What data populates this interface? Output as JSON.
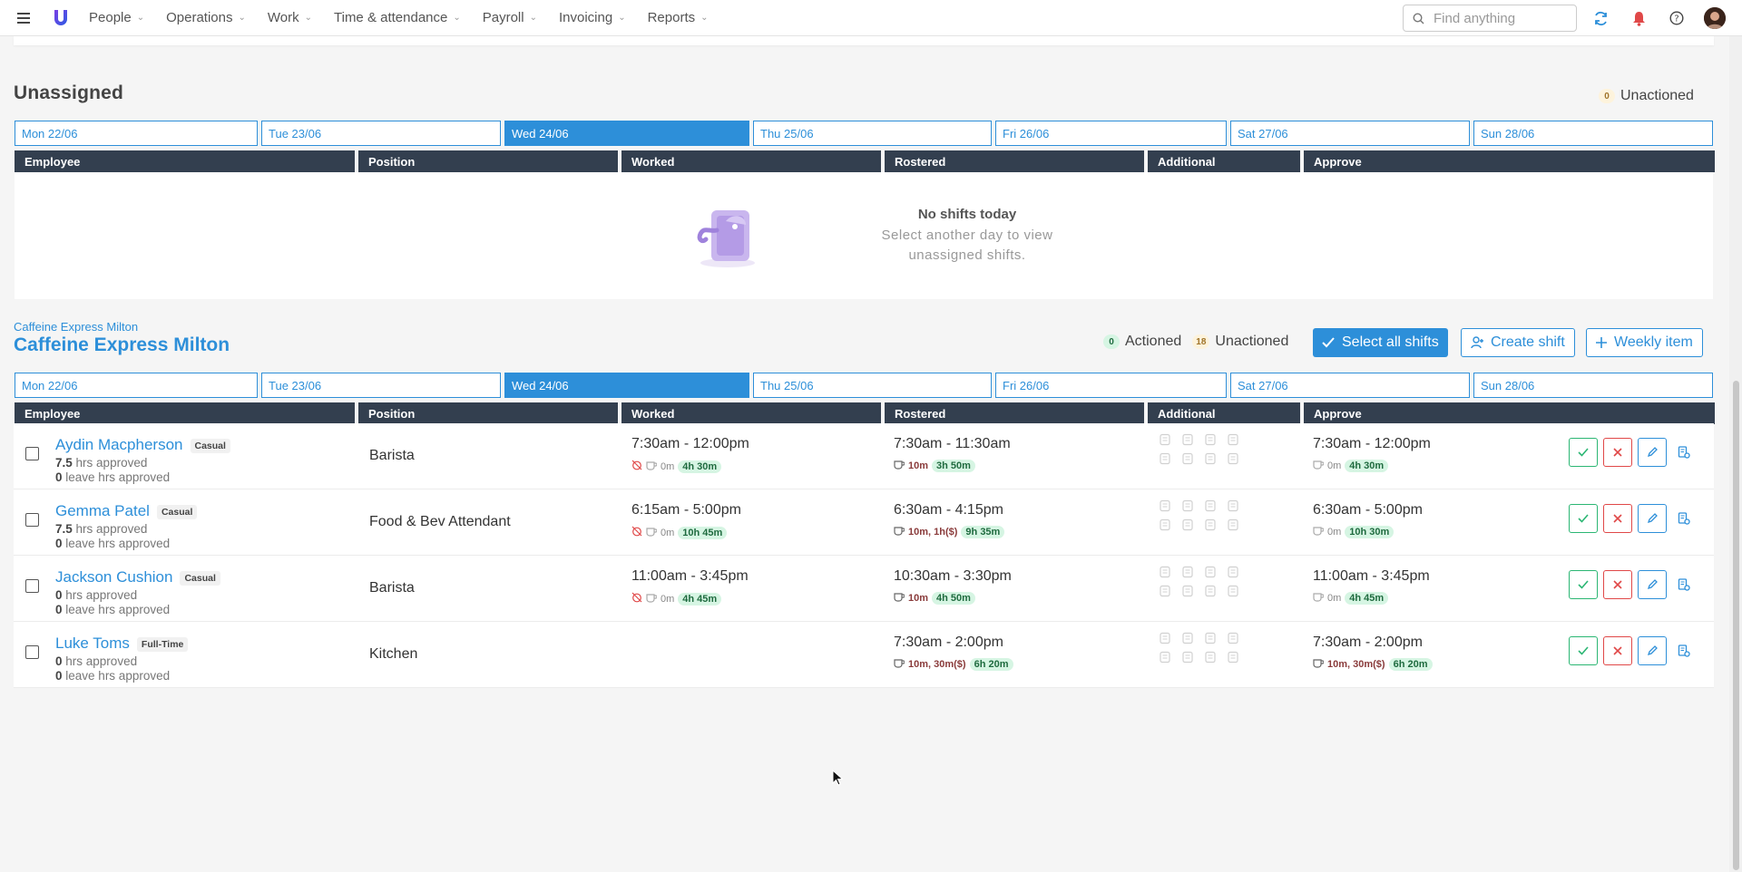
{
  "nav": {
    "items": [
      "People",
      "Operations",
      "Work",
      "Time & attendance",
      "Payroll",
      "Invoicing",
      "Reports"
    ],
    "search_placeholder": "Find anything"
  },
  "unassigned": {
    "title": "Unassigned",
    "unactioned_count": "0",
    "unactioned_label": "Unactioned",
    "empty_title": "No shifts today",
    "empty_line1": "Select another day to view",
    "empty_line2": "unassigned shifts."
  },
  "days": [
    "Mon 22/06",
    "Tue 23/06",
    "Wed 24/06",
    "Thu 25/06",
    "Fri 26/06",
    "Sat 27/06",
    "Sun 28/06"
  ],
  "active_day": "Wed 24/06",
  "columns": [
    "Employee",
    "Position",
    "Worked",
    "Rostered",
    "Additional",
    "Approve"
  ],
  "site": {
    "small_name": "Caffeine Express Milton",
    "name": "Caffeine Express Milton",
    "actioned_count": "0",
    "actioned_label": "Actioned",
    "unactioned_count": "18",
    "unactioned_label": "Unactioned",
    "select_all_label": "Select all shifts",
    "create_shift_label": "Create shift",
    "weekly_item_label": "Weekly item"
  },
  "rows": [
    {
      "name": "Aydin Macpherson",
      "type": "Casual",
      "hrs": "7.5",
      "hrs_label": "hrs approved",
      "leave": "0",
      "leave_label": "leave hrs approved",
      "position": "Barista",
      "worked": "7:30am - 12:00pm",
      "worked_break": "0m",
      "worked_total": "4h 30m",
      "rostered": "7:30am - 11:30am",
      "rostered_break": "10m",
      "rostered_total": "3h 50m",
      "approve": "7:30am - 12:00pm",
      "approve_break": "0m",
      "approve_total": "4h 30m"
    },
    {
      "name": "Gemma Patel",
      "type": "Casual",
      "hrs": "7.5",
      "hrs_label": "hrs approved",
      "leave": "0",
      "leave_label": "leave hrs approved",
      "position": "Food & Bev Attendant",
      "worked": "6:15am - 5:00pm",
      "worked_break": "0m",
      "worked_total": "10h 45m",
      "rostered": "6:30am - 4:15pm",
      "rostered_break": "10m, 1h($)",
      "rostered_total": "9h 35m",
      "approve": "6:30am - 5:00pm",
      "approve_break": "0m",
      "approve_total": "10h 30m"
    },
    {
      "name": "Jackson Cushion",
      "type": "Casual",
      "hrs": "0",
      "hrs_label": "hrs approved",
      "leave": "0",
      "leave_label": "leave hrs approved",
      "position": "Barista",
      "worked": "11:00am - 3:45pm",
      "worked_break": "0m",
      "worked_total": "4h 45m",
      "rostered": "10:30am - 3:30pm",
      "rostered_break": "10m",
      "rostered_total": "4h 50m",
      "approve": "11:00am - 3:45pm",
      "approve_break": "0m",
      "approve_total": "4h 45m"
    },
    {
      "name": "Luke Toms",
      "type": "Full-Time",
      "hrs": "0",
      "hrs_label": "hrs approved",
      "leave": "0",
      "leave_label": "leave hrs approved",
      "position": "Kitchen",
      "worked": "",
      "worked_break": "",
      "worked_total": "",
      "rostered": "7:30am - 2:00pm",
      "rostered_break": "10m, 30m($)",
      "rostered_total": "6h 20m",
      "approve": "7:30am - 2:00pm",
      "approve_break": "10m, 30m($)",
      "approve_total": "6h 20m"
    }
  ],
  "colors": {
    "accent": "#2d8fd9",
    "header": "#333f4f",
    "approve": "#2bb673",
    "reject": "#e04848"
  }
}
